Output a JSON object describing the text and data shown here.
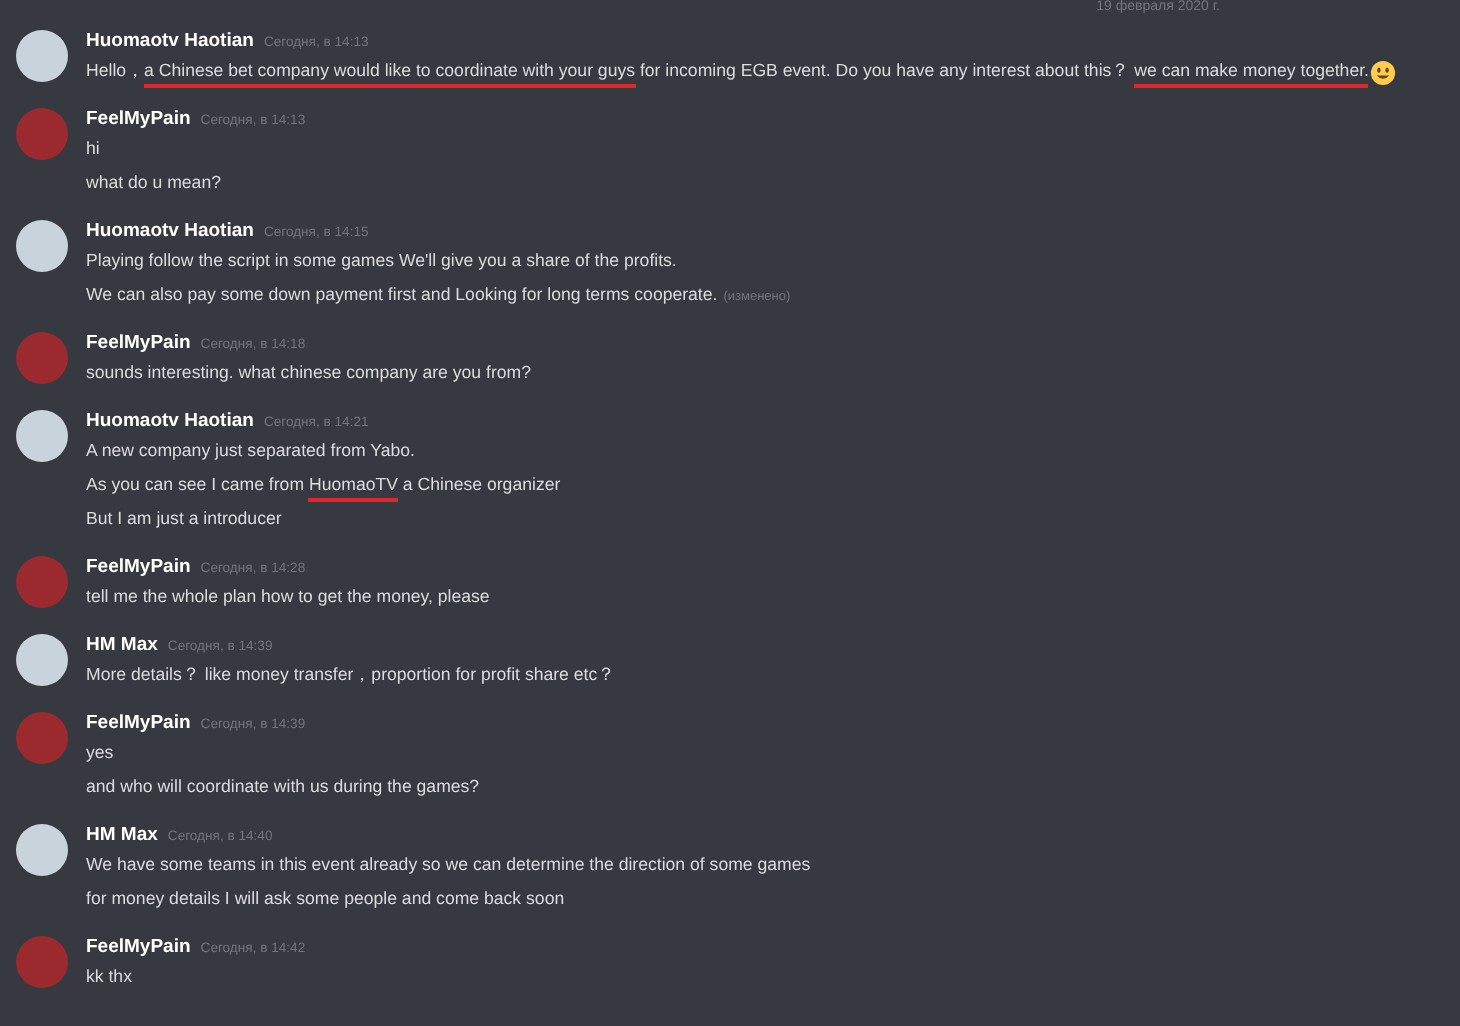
{
  "date_divider": "19 февраля 2020 г.",
  "messages": [
    {
      "author": "Huomaotv Haotian",
      "color": "#c9d3dc",
      "timestamp": "Сегодня, в 14:13",
      "lines": [
        {
          "emoji": true,
          "segments": [
            {
              "text": "Hello，",
              "underlined": false
            },
            {
              "text": "a Chinese bet company would like to coordinate with your guys",
              "underlined": true
            },
            {
              "text": " for incoming EGB event. Do you have any interest about this？ ",
              "underlined": false
            },
            {
              "text": "we can make money together.",
              "underlined": true
            }
          ]
        }
      ]
    },
    {
      "author": "FeelMyPain",
      "color": "#9b2a2e",
      "timestamp": "Сегодня, в 14:13",
      "lines": [
        {
          "emoji": false,
          "segments": [
            {
              "text": "hi",
              "underlined": false
            }
          ]
        },
        {
          "emoji": false,
          "segments": [
            {
              "text": "what do u mean?",
              "underlined": false
            }
          ]
        }
      ]
    },
    {
      "author": "Huomaotv Haotian",
      "color": "#c9d3dc",
      "timestamp": "Сегодня, в 14:15",
      "lines": [
        {
          "emoji": false,
          "segments": [
            {
              "text": "Playing follow the script in some games We'll give you a share of the profits.",
              "underlined": false
            }
          ]
        },
        {
          "emoji": false,
          "edited": "(изменено)",
          "segments": [
            {
              "text": "We can also pay some down payment first and Looking for long terms cooperate.",
              "underlined": false
            }
          ]
        }
      ]
    },
    {
      "author": "FeelMyPain",
      "color": "#9b2a2e",
      "timestamp": "Сегодня, в 14:18",
      "lines": [
        {
          "emoji": false,
          "segments": [
            {
              "text": "sounds interesting. what chinese company are you from?",
              "underlined": false
            }
          ]
        }
      ]
    },
    {
      "author": "Huomaotv Haotian",
      "color": "#c9d3dc",
      "timestamp": "Сегодня, в 14:21",
      "lines": [
        {
          "emoji": false,
          "segments": [
            {
              "text": "A new company just separated from Yabo.",
              "underlined": false
            }
          ]
        },
        {
          "emoji": false,
          "segments": [
            {
              "text": "As you can see I came from ",
              "underlined": false
            },
            {
              "text": "HuomaoTV",
              "underlined": true
            },
            {
              "text": " a Chinese organizer",
              "underlined": false
            }
          ]
        },
        {
          "emoji": false,
          "segments": [
            {
              "text": "But I am just a introducer",
              "underlined": false
            }
          ]
        }
      ]
    },
    {
      "author": "FeelMyPain",
      "color": "#9b2a2e",
      "timestamp": "Сегодня, в 14:28",
      "lines": [
        {
          "emoji": false,
          "segments": [
            {
              "text": "tell me the whole plan how to get the money, please",
              "underlined": false
            }
          ]
        }
      ]
    },
    {
      "author": "HM Max",
      "color": "#c9d3dc",
      "timestamp": "Сегодня, в 14:39",
      "lines": [
        {
          "emoji": false,
          "segments": [
            {
              "text": "More details？ like money transfer，proportion for profit share etc？",
              "underlined": false
            }
          ]
        }
      ]
    },
    {
      "author": "FeelMyPain",
      "color": "#9b2a2e",
      "timestamp": "Сегодня, в 14:39",
      "lines": [
        {
          "emoji": false,
          "segments": [
            {
              "text": "yes",
              "underlined": false
            }
          ]
        },
        {
          "emoji": false,
          "segments": [
            {
              "text": "and who will coordinate with us during the games?",
              "underlined": false
            }
          ]
        }
      ]
    },
    {
      "author": "HM Max",
      "color": "#c9d3dc",
      "timestamp": "Сегодня, в 14:40",
      "lines": [
        {
          "emoji": false,
          "segments": [
            {
              "text": "We have some teams in this event already so we can determine the direction of some games",
              "underlined": false
            }
          ]
        },
        {
          "emoji": false,
          "segments": [
            {
              "text": "for money details I will ask some people and come back soon",
              "underlined": false
            }
          ]
        }
      ]
    },
    {
      "author": "FeelMyPain",
      "color": "#9b2a2e",
      "timestamp": "Сегодня, в 14:42",
      "lines": [
        {
          "emoji": false,
          "segments": [
            {
              "text": "kk thx",
              "underlined": false
            }
          ]
        }
      ]
    }
  ]
}
